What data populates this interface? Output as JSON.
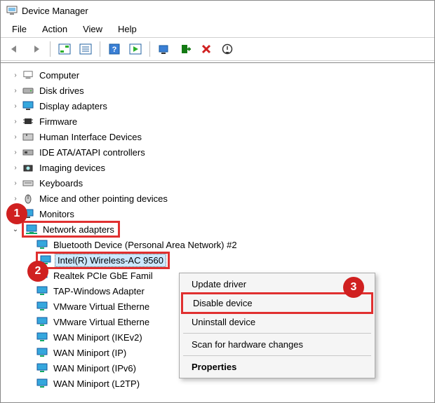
{
  "window": {
    "title": "Device Manager"
  },
  "menu": {
    "file": "File",
    "action": "Action",
    "view": "View",
    "help": "Help"
  },
  "tree": {
    "computer": "Computer",
    "disk": "Disk drives",
    "display": "Display adapters",
    "firmware": "Firmware",
    "hid": "Human Interface Devices",
    "ide": "IDE ATA/ATAPI controllers",
    "imaging": "Imaging devices",
    "keyboards": "Keyboards",
    "mice": "Mice and other pointing devices",
    "monitors": "Monitors",
    "network": "Network adapters",
    "net_children": {
      "bt": "Bluetooth Device (Personal Area Network) #2",
      "intel": "Intel(R) Wireless-AC 9560",
      "realtek": "Realtek PCIe GbE Famil",
      "tap": "TAP-Windows Adapter",
      "vmw1": "VMware Virtual Etherne",
      "vmw2": "VMware Virtual Etherne",
      "wan_ikev2": "WAN Miniport (IKEv2)",
      "wan_ip": "WAN Miniport (IP)",
      "wan_ipv6": "WAN Miniport (IPv6)",
      "wan_l2tp": "WAN Miniport (L2TP)"
    }
  },
  "context_menu": {
    "update": "Update driver",
    "disable": "Disable device",
    "uninstall": "Uninstall device",
    "scan": "Scan for hardware changes",
    "properties": "Properties"
  },
  "callouts": {
    "c1": "1",
    "c2": "2",
    "c3": "3"
  }
}
